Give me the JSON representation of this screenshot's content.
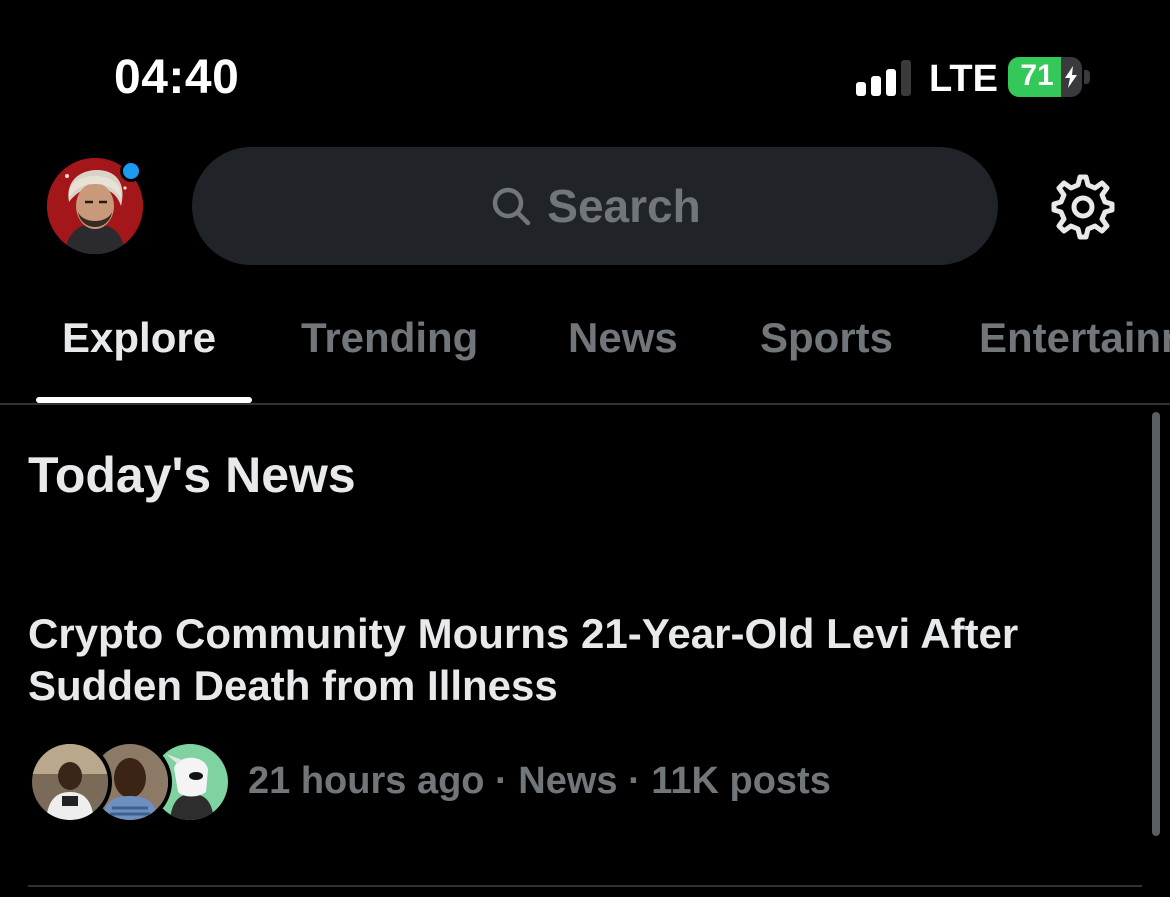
{
  "status_bar": {
    "time": "04:40",
    "signal_bars_active": 3,
    "signal_bars_total": 4,
    "network": "LTE",
    "battery_percent": "71",
    "battery_level": 0.71,
    "charging": true
  },
  "header": {
    "search_placeholder": "Search",
    "notification_dot": true
  },
  "tabs": [
    {
      "label": "Explore",
      "active": true
    },
    {
      "label": "Trending",
      "active": false
    },
    {
      "label": "News",
      "active": false
    },
    {
      "label": "Sports",
      "active": false
    },
    {
      "label": "Entertainment",
      "active": false
    }
  ],
  "section": {
    "title": "Today's News"
  },
  "story": {
    "headline": "Crypto Community Mourns 21-Year-Old Levi After Sudden Death from Illness",
    "meta": "21 hours ago · News · 11K posts"
  },
  "colors": {
    "background": "#000000",
    "accent": "#1d9bf0",
    "text_primary": "#e7e9ea",
    "text_secondary": "#71767b",
    "search_bg": "#202327",
    "battery_green": "#34c759"
  },
  "icons": [
    "search-icon",
    "gear-icon",
    "avatar",
    "lightning-icon"
  ]
}
